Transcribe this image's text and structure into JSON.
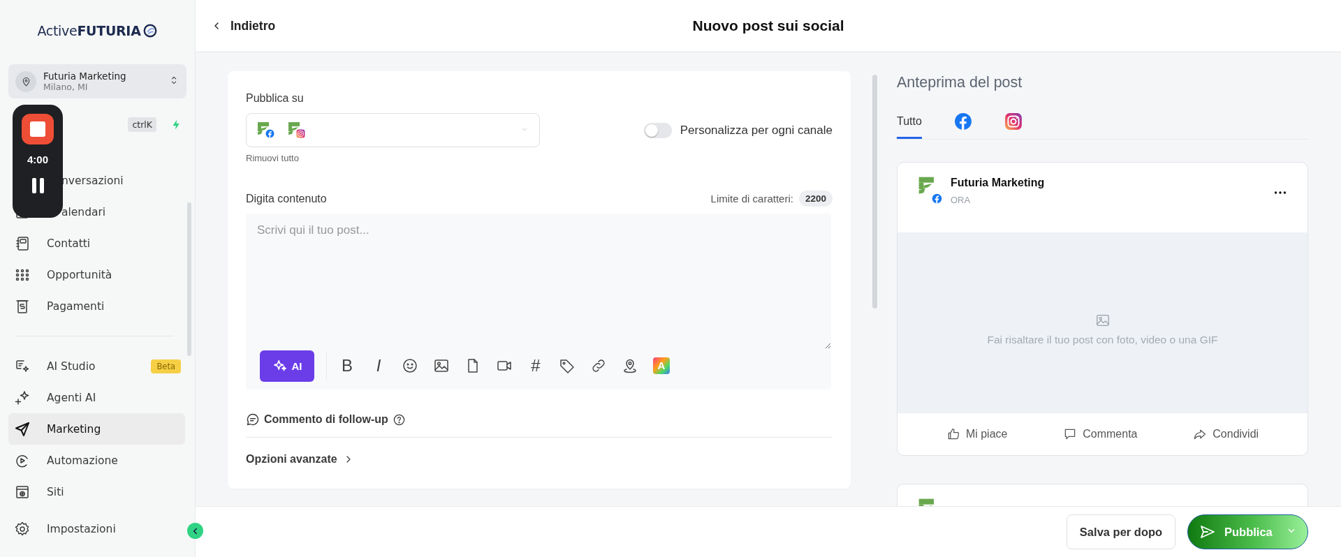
{
  "sidebar": {
    "logo": "Active**FUTURIA**",
    "account": {
      "name": "Futuria Marketing",
      "location": "Milano, MI"
    },
    "search": {
      "shortcut": "ctrlK"
    },
    "nav": [
      {
        "kind": "conversations",
        "label": "nversazioni",
        "obscured": true,
        "selected": false
      },
      {
        "kind": "calendar",
        "label": "alendari",
        "obscured": true,
        "selected": false
      },
      {
        "kind": "contacts",
        "label": "Contatti",
        "obscured": false,
        "selected": false
      },
      {
        "kind": "opportunities",
        "label": "Opportunità",
        "obscured": false,
        "selected": false
      },
      {
        "kind": "payments",
        "label": "Pagamenti",
        "obscured": false,
        "selected": false
      },
      {
        "kind": "divider"
      },
      {
        "kind": "ai-studio",
        "label": "AI Studio",
        "badge": "Beta",
        "obscured": false,
        "selected": false
      },
      {
        "kind": "agents",
        "label": "Agenti AI",
        "obscured": false,
        "selected": false
      },
      {
        "kind": "send",
        "label": "Marketing",
        "obscured": false,
        "selected": true
      },
      {
        "kind": "automation",
        "label": "Automazione",
        "obscured": false,
        "selected": false
      },
      {
        "kind": "sites",
        "label": "Siti",
        "obscured": false,
        "selected": false
      }
    ],
    "settings": {
      "label": "Impostazioni"
    }
  },
  "recorder": {
    "time": "4:00"
  },
  "header": {
    "back": "Indietro",
    "title": "Nuovo post sui social"
  },
  "composer": {
    "publish_on": {
      "label": "Pubblica su",
      "channels": [
        {
          "kind": "facebook"
        },
        {
          "kind": "instagram"
        }
      ],
      "clear": "Rimuovi tutto"
    },
    "toggle": {
      "label": "Personalizza per ogni canale",
      "on": false
    },
    "content": {
      "label": "Digita contenuto",
      "limit_label": "Limite di caratteri:",
      "limit": "2200",
      "placeholder": "Scrivi qui il tuo post...",
      "ai": "AI",
      "tools": [
        {
          "kind": "bold",
          "glyph": "B"
        },
        {
          "kind": "italic",
          "glyph": "I"
        },
        {
          "kind": "emoji"
        },
        {
          "kind": "image"
        },
        {
          "kind": "file"
        },
        {
          "kind": "video"
        },
        {
          "kind": "hashtag",
          "glyph": "#"
        },
        {
          "kind": "tag"
        },
        {
          "kind": "link"
        },
        {
          "kind": "location"
        },
        {
          "kind": "brand",
          "glyph": "A"
        }
      ]
    },
    "follow_up": "Commento di follow-up",
    "advanced": "Opzioni avanzate"
  },
  "preview": {
    "title": "Anteprima del post",
    "tabs": [
      {
        "kind": "text",
        "label": "Tutto",
        "selected": true
      },
      {
        "kind": "facebook",
        "selected": false
      },
      {
        "kind": "instagram",
        "selected": false
      }
    ],
    "cards": [
      {
        "kind": "facebook",
        "name": "Futuria Marketing",
        "time": "ORA",
        "media_hint": "Fai risaltare il tuo post con foto, video o una GIF",
        "actions": [
          {
            "kind": "like",
            "label": "Mi piace"
          },
          {
            "kind": "comment",
            "label": "Commenta"
          },
          {
            "kind": "share",
            "label": "Condividi"
          }
        ]
      },
      {
        "kind": "cut"
      }
    ]
  },
  "footer": {
    "save": "Salva per dopo",
    "publish": "Pubblica"
  }
}
